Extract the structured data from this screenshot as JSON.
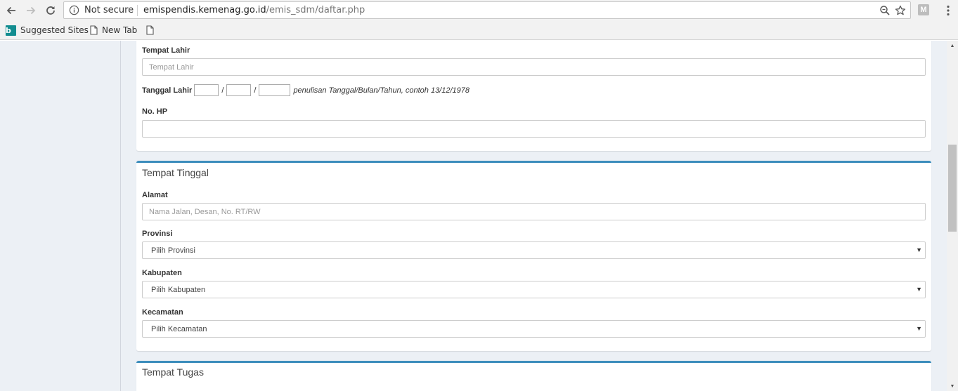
{
  "browser": {
    "security_label": "Not secure",
    "url_host": "emispendis.kemenag.go.id",
    "url_path": "/emis_sdm/daftar.php",
    "profile_initial": "M",
    "bookmarks": [
      {
        "label": "Suggested Sites"
      },
      {
        "label": "New Tab"
      }
    ]
  },
  "form": {
    "personal": {
      "tempat_lahir_label": "Tempat Lahir",
      "tempat_lahir_placeholder": "Tempat Lahir",
      "tanggal_lahir_label": "Tanggal Lahir",
      "date_separator": "/",
      "tanggal_lahir_hint": "penulisan Tanggal/Bulan/Tahun, contoh 13/12/1978",
      "no_hp_label": "No. HP",
      "no_hp_value": ""
    },
    "tempat_tinggal": {
      "title": "Tempat Tinggal",
      "alamat_label": "Alamat",
      "alamat_placeholder": "Nama Jalan, Desan, No. RT/RW",
      "provinsi_label": "Provinsi",
      "provinsi_selected": "Pilih Provinsi",
      "kabupaten_label": "Kabupaten",
      "kabupaten_selected": "Pilih Kabupaten",
      "kecamatan_label": "Kecamatan",
      "kecamatan_selected": "Pilih Kecamatan"
    },
    "tempat_tugas": {
      "title": "Tempat Tugas"
    }
  },
  "colors": {
    "box_top_border": "#3c8dbc",
    "page_background": "#ecf0f5",
    "bing_brand": "#138d90"
  }
}
